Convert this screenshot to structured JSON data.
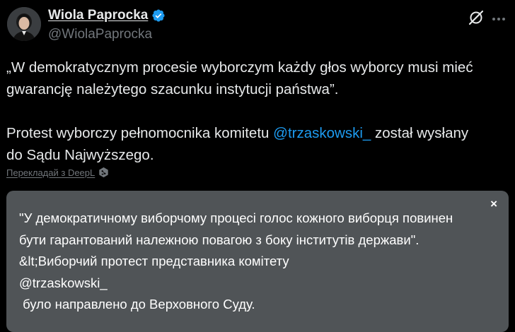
{
  "author": {
    "display_name": "Wiola Paprocka",
    "handle": "@WiolaPaprocka",
    "verified_color": "#1d9bf0"
  },
  "header_icons": [
    "grok-icon",
    "more-icon"
  ],
  "tweet": {
    "paragraph1_line1": "„W demokratycznym procesie wyborczym każdy głos wyborcy musi mieć",
    "paragraph1_line2": "gwarancję należytego szacunku instytucji państwa”.",
    "paragraph2_before": "Protest wyborczy pełnomocnika komitetu ",
    "paragraph2_mention": "@trzaskowski_",
    "paragraph2_after": " został wysłany",
    "paragraph2_line2": "do Sądu Najwyższego.",
    "mention_color": "#1d9bf0"
  },
  "translate": {
    "link_label": "Перекладай з DeepL",
    "icon": "deepl-icon"
  },
  "translation": {
    "close_label": "×",
    "lines": [
      "\"У демократичному виборчому процесі голос кожного виборця повинен",
      "бути гарантований належною повагою з боку інститутів держави\".",
      "&lt;Виборчий протест представника комітету",
      "@trzaskowski_",
      " було направлено до Верховного Суду."
    ],
    "box_color": "#505457"
  }
}
